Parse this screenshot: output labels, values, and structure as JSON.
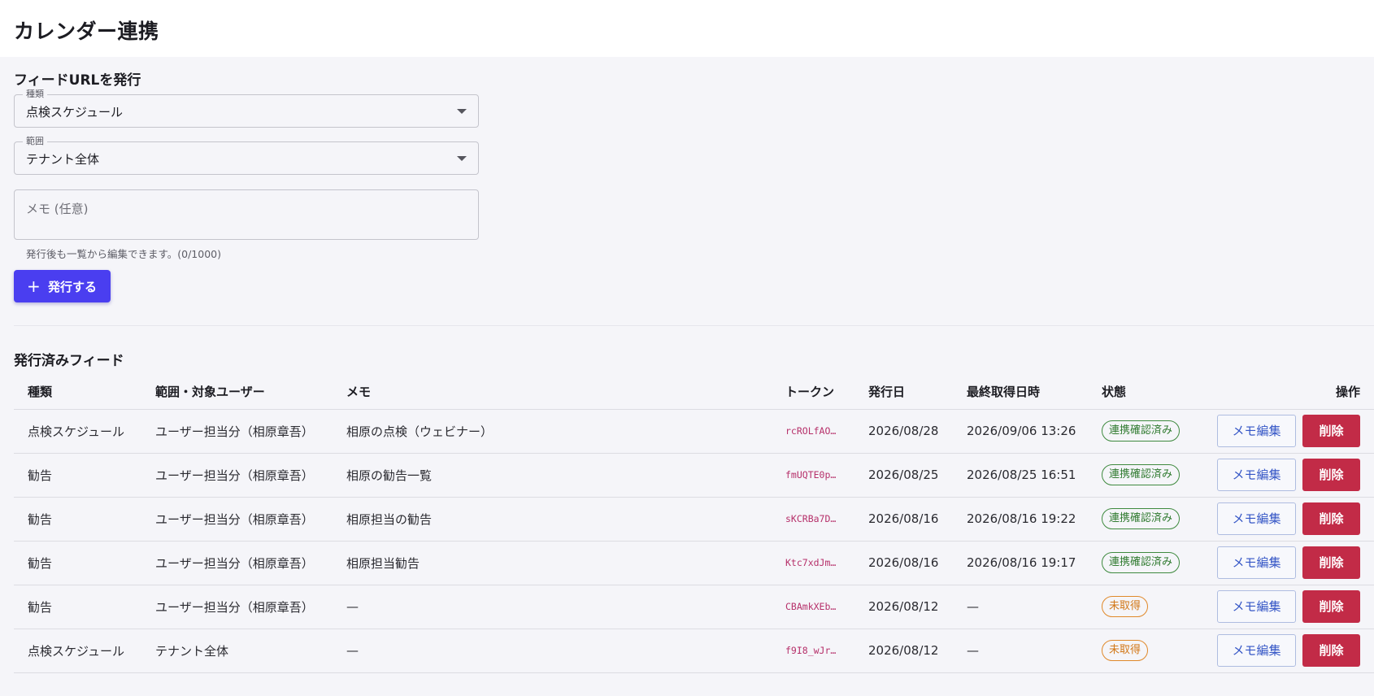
{
  "page": {
    "title": "カレンダー連携"
  },
  "issue_form": {
    "section_title": "フィードURLを発行",
    "type_label": "種類",
    "type_value": "点検スケジュール",
    "scope_label": "範囲",
    "scope_value": "テナント全体",
    "memo_placeholder": "メモ (任意)",
    "helper_text": "発行後も一覧から編集できます。(0/1000)",
    "issue_button_label": "発行する"
  },
  "feeds": {
    "section_title": "発行済みフィード",
    "columns": [
      "種類",
      "範囲・対象ユーザー",
      "メモ",
      "トークン",
      "発行日",
      "最終取得日時",
      "状態",
      "操作"
    ],
    "edit_label": "メモ編集",
    "delete_label": "削除",
    "rows": [
      {
        "type": "点検スケジュール",
        "scope": "ユーザー担当分（相原章吾）",
        "memo": "相原の点検（ウェビナー）",
        "token": "rcROLfAO…",
        "issued": "2026/08/28",
        "last_fetched": "2026/09/06 13:26",
        "status": "連携確認済み"
      },
      {
        "type": "勧告",
        "scope": "ユーザー担当分（相原章吾）",
        "memo": "相原の勧告一覧",
        "token": "fmUQTE0p…",
        "issued": "2026/08/25",
        "last_fetched": "2026/08/25 16:51",
        "status": "連携確認済み"
      },
      {
        "type": "勧告",
        "scope": "ユーザー担当分（相原章吾）",
        "memo": "相原担当の勧告",
        "token": "sKCRBa7D…",
        "issued": "2026/08/16",
        "last_fetched": "2026/08/16 19:22",
        "status": "連携確認済み"
      },
      {
        "type": "勧告",
        "scope": "ユーザー担当分（相原章吾）",
        "memo": "相原担当勧告",
        "token": "Ktc7xdJm…",
        "issued": "2026/08/16",
        "last_fetched": "2026/08/16 19:17",
        "status": "連携確認済み"
      },
      {
        "type": "勧告",
        "scope": "ユーザー担当分（相原章吾）",
        "memo": "—",
        "token": "CBAmkXEb…",
        "issued": "2026/08/12",
        "last_fetched": "—",
        "status": "未取得"
      },
      {
        "type": "点検スケジュール",
        "scope": "テナント全体",
        "memo": "—",
        "token": "f9I8_wJr…",
        "issued": "2026/08/12",
        "last_fetched": "—",
        "status": "未取得"
      }
    ]
  },
  "colors": {
    "accent": "#4a3ef0",
    "danger": "#c22b47",
    "ok": "#2f7a2f",
    "pending": "#d27818",
    "token": "#b6306a"
  }
}
